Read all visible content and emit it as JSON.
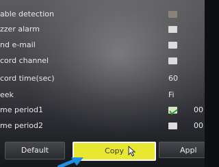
{
  "settings": {
    "rows": [
      {
        "label": "able detection"
      },
      {
        "label": "zzer alarm"
      },
      {
        "label": "nd e-mail"
      },
      {
        "label": "cord channel"
      },
      {
        "label": "cord time(sec)",
        "value": "60"
      },
      {
        "label": "eek",
        "value": "Fi"
      },
      {
        "label": "me period1",
        "value2": "00"
      },
      {
        "label": "me period2",
        "value2": "00"
      }
    ]
  },
  "buttons": {
    "default_label": "Default",
    "copy_label": "Copy",
    "apply_label": "Appl"
  },
  "colors": {
    "copy_button": "#e8e832",
    "annotation_arrow": "#1e90e6",
    "checkbox_check": "#2e9a2e"
  },
  "icons": [
    "checkbox",
    "mouse-cursor-icon",
    "annotation-arrow-icon"
  ]
}
